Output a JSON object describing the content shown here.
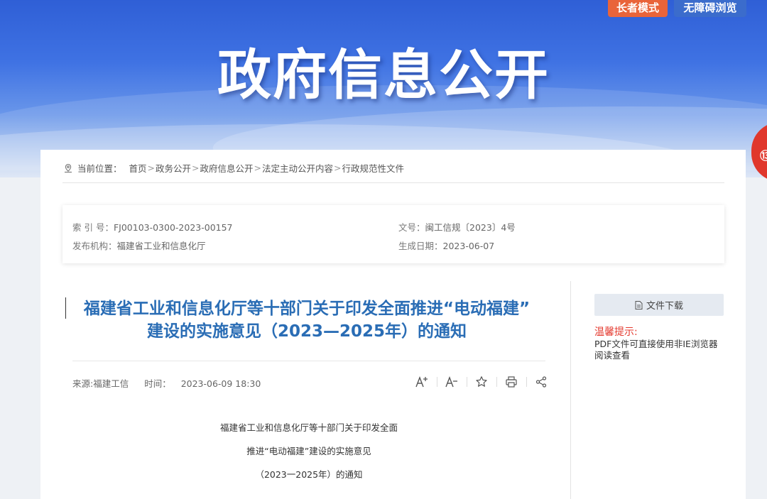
{
  "header": {
    "title": "政府信息公开",
    "elder_mode_label": "长者模式",
    "accessibility_label": "无障碍浏览",
    "side_float_label": "⑬"
  },
  "breadcrumb": {
    "prefix": "当前位置：",
    "items": [
      "首页",
      "政务公开",
      "政府信息公开",
      "法定主动公开内容",
      "行政规范性文件"
    ],
    "separator": ">"
  },
  "meta": {
    "index_label": "索 引 号：",
    "index_value": "FJ00103-0300-2023-00157",
    "doc_no_label": "文号：",
    "doc_no_value": "闽工信规〔2023〕4号",
    "publisher_label": "发布机构：",
    "publisher_value": "福建省工业和信息化厅",
    "date_label": "生成日期：",
    "date_value": "2023-06-07"
  },
  "article": {
    "title_line1": "福建省工业和信息化厅等十部门关于印发全面推进“电动福建”",
    "title_line2": "建设的实施意见（2023—2025年）的通知",
    "source_label": "来源:",
    "source_value": "福建工信",
    "time_label": "时间：",
    "time_value": "2023-06-09 18:30",
    "body": [
      "福建省工业和信息化厅等十部门关于印发全面",
      "推进“电动福建”建设的实施意见",
      "（2023一2025年）的通知"
    ]
  },
  "tools": {
    "font_increase": "A+",
    "font_decrease": "A−",
    "favorite": "☆",
    "print": "⎙",
    "share": "share"
  },
  "sidebar": {
    "download_label": "文件下载",
    "tips_title": "温馨提示:",
    "tips_body": "PDF文件可直接使用非IE浏览器阅读查看"
  },
  "colors": {
    "title_blue": "#2a6db5",
    "tips_red": "#e43a2f",
    "elder_orange": "#e9643a",
    "access_blue": "#3b6ccc"
  }
}
